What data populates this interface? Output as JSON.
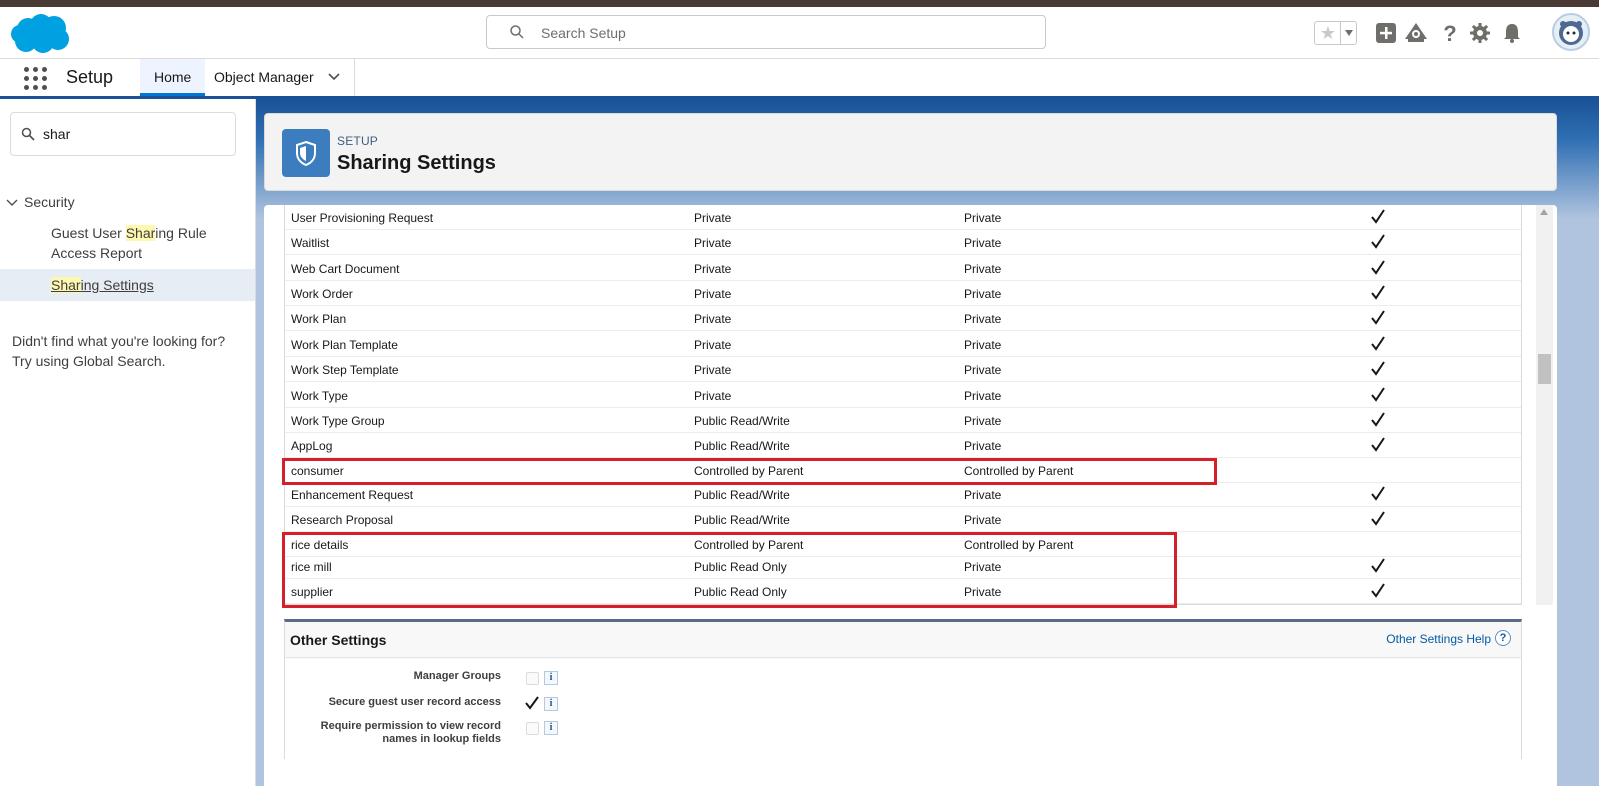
{
  "header": {
    "search_placeholder": "Search Setup",
    "icons": [
      "favorites-star-icon",
      "favorites-dropdown-icon",
      "global-actions-icon",
      "trailhead-icon",
      "help-icon",
      "gear-icon",
      "notifications-bell-icon",
      "avatar"
    ]
  },
  "context_bar": {
    "app_name": "Setup",
    "tabs": [
      {
        "label": "Home",
        "active": true
      },
      {
        "label": "Object Manager",
        "has_dropdown": true
      }
    ]
  },
  "sidebar": {
    "quickfind_value": "shar",
    "section": "Security",
    "items": [
      {
        "pre": "Guest User ",
        "hl": "Shar",
        "post": "ing Rule Access Report",
        "selected": false
      },
      {
        "pre": "",
        "hl": "Shar",
        "post": "ing Settings",
        "selected": true
      }
    ],
    "help_line1": "Didn't find what you're looking for?",
    "help_line2": "Try using Global Search."
  },
  "page_header": {
    "eyebrow": "SETUP",
    "title": "Sharing Settings"
  },
  "sharing_table": {
    "rows": [
      {
        "object": "User Provisioning Request",
        "internal": "Private",
        "external": "Private",
        "grant": true
      },
      {
        "object": "Waitlist",
        "internal": "Private",
        "external": "Private",
        "grant": true
      },
      {
        "object": "Web Cart Document",
        "internal": "Private",
        "external": "Private",
        "grant": true
      },
      {
        "object": "Work Order",
        "internal": "Private",
        "external": "Private",
        "grant": true
      },
      {
        "object": "Work Plan",
        "internal": "Private",
        "external": "Private",
        "grant": true
      },
      {
        "object": "Work Plan Template",
        "internal": "Private",
        "external": "Private",
        "grant": true
      },
      {
        "object": "Work Step Template",
        "internal": "Private",
        "external": "Private",
        "grant": true
      },
      {
        "object": "Work Type",
        "internal": "Private",
        "external": "Private",
        "grant": true
      },
      {
        "object": "Work Type Group",
        "internal": "Public Read/Write",
        "external": "Private",
        "grant": true
      },
      {
        "object": "AppLog",
        "internal": "Public Read/Write",
        "external": "Private",
        "grant": true
      },
      {
        "object": "consumer",
        "internal": "Controlled by Parent",
        "external": "Controlled by Parent",
        "grant": false
      },
      {
        "object": "Enhancement Request",
        "internal": "Public Read/Write",
        "external": "Private",
        "grant": true
      },
      {
        "object": "Research Proposal",
        "internal": "Public Read/Write",
        "external": "Private",
        "grant": true
      },
      {
        "object": "rice details",
        "internal": "Controlled by Parent",
        "external": "Controlled by Parent",
        "grant": false
      },
      {
        "object": "rice mill",
        "internal": "Public Read Only",
        "external": "Private",
        "grant": true
      },
      {
        "object": "supplier",
        "internal": "Public Read Only",
        "external": "Private",
        "grant": true
      }
    ]
  },
  "other_settings": {
    "title": "Other Settings",
    "help_link": "Other Settings Help",
    "help_icon": "?",
    "info_icon": "i",
    "settings": [
      {
        "label": "Manager Groups",
        "checked": false
      },
      {
        "label": "Secure guest user record access",
        "checked": true
      },
      {
        "label_line1": "Require permission to view record",
        "label_line2": "names in lookup fields",
        "checked": false
      }
    ]
  },
  "colors": {
    "brand_blue": "#0176d3",
    "highlight_box": "#d4202a",
    "search_highlight": "#fdf7b0"
  }
}
